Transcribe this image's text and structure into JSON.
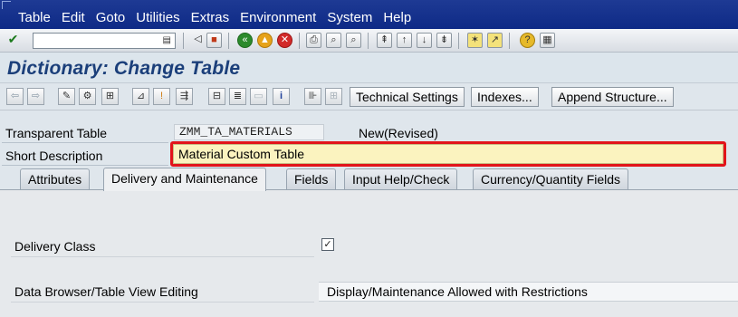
{
  "menu": [
    "Table",
    "Edit",
    "Goto",
    "Utilities",
    "Extras",
    "Environment",
    "System",
    "Help"
  ],
  "command_field": {
    "value": "",
    "placeholder": ""
  },
  "screen_title": "Dictionary: Change Table",
  "app_toolbar": {
    "technical_settings": "Technical Settings",
    "indexes": "Indexes...",
    "append_structure": "Append Structure..."
  },
  "header": {
    "table_type_label": "Transparent Table",
    "table_name": "ZMM_TA_MATERIALS",
    "status": "New(Revised)",
    "short_desc_label": "Short Description",
    "short_desc_value": "Material Custom Table"
  },
  "tabs": [
    "Attributes",
    "Delivery and Maintenance",
    "Fields",
    "Input Help/Check",
    "Currency/Quantity Fields"
  ],
  "active_tab": "Delivery and Maintenance",
  "panel": {
    "delivery_class_label": "Delivery Class",
    "delivery_class_checked": true,
    "data_browser_label": "Data Browser/Table View Editing",
    "data_browser_value": "Display/Maintenance Allowed with Restrictions"
  },
  "colors": {
    "menu_bg": "#0e2a86",
    "title": "#1b3f7a",
    "highlight": "#e2141a",
    "field_bg": "#fbf3bf"
  }
}
